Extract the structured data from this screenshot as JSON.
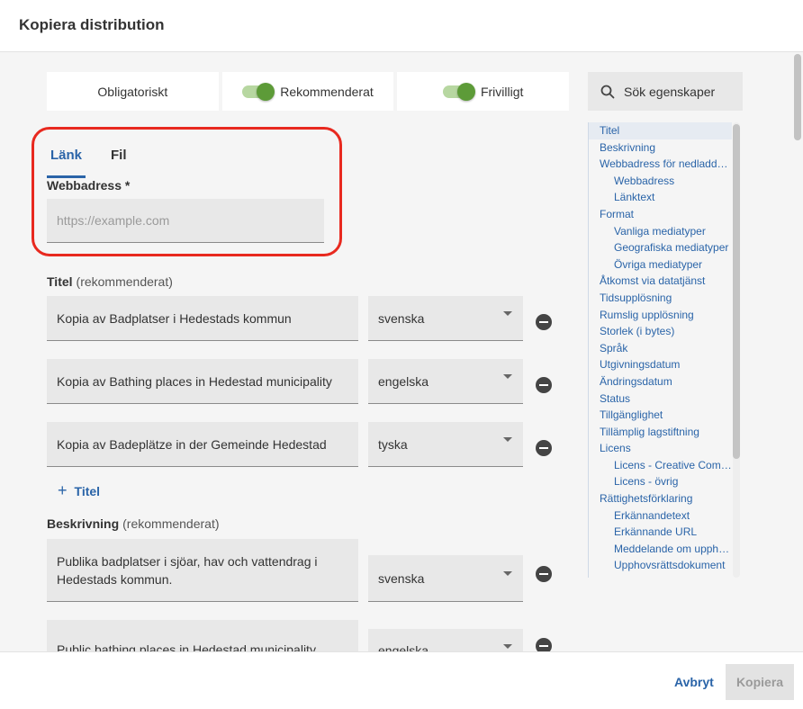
{
  "dialog": {
    "title": "Kopiera distribution"
  },
  "filters": {
    "mandatory": "Obligatoriskt",
    "recommended": "Rekommenderat",
    "optional": "Frivilligt"
  },
  "search": {
    "label": "Sök egenskaper"
  },
  "toc": [
    {
      "label": "Titel",
      "sub": false,
      "active": true
    },
    {
      "label": "Beskrivning",
      "sub": false
    },
    {
      "label": "Webbadress för nedladdning",
      "sub": false
    },
    {
      "label": "Webbadress",
      "sub": true
    },
    {
      "label": "Länktext",
      "sub": true
    },
    {
      "label": "Format",
      "sub": false
    },
    {
      "label": "Vanliga mediatyper",
      "sub": true
    },
    {
      "label": "Geografiska mediatyper",
      "sub": true
    },
    {
      "label": "Övriga mediatyper",
      "sub": true
    },
    {
      "label": "Åtkomst via datatjänst",
      "sub": false
    },
    {
      "label": "Tidsupplösning",
      "sub": false
    },
    {
      "label": "Rumslig upplösning",
      "sub": false
    },
    {
      "label": "Storlek (i bytes)",
      "sub": false
    },
    {
      "label": "Språk",
      "sub": false
    },
    {
      "label": "Utgivningsdatum",
      "sub": false
    },
    {
      "label": "Ändringsdatum",
      "sub": false
    },
    {
      "label": "Status",
      "sub": false
    },
    {
      "label": "Tillgänglighet",
      "sub": false
    },
    {
      "label": "Tillämplig lagstiftning",
      "sub": false
    },
    {
      "label": "Licens",
      "sub": false
    },
    {
      "label": "Licens - Creative Commons",
      "sub": true
    },
    {
      "label": "Licens - övrig",
      "sub": true
    },
    {
      "label": "Rättighetsförklaring",
      "sub": false
    },
    {
      "label": "Erkännandetext",
      "sub": true
    },
    {
      "label": "Erkännande URL",
      "sub": true
    },
    {
      "label": "Meddelande om upphovsrätt",
      "sub": true
    },
    {
      "label": "Upphovsrättsdokument",
      "sub": true
    }
  ],
  "tabs": {
    "link": "Länk",
    "file": "Fil"
  },
  "url": {
    "label": "Webbadress *",
    "placeholder": "https://example.com"
  },
  "title_section": {
    "label": "Titel",
    "hint": "(rekommenderat)",
    "rows": [
      {
        "value": "Kopia av Badplatser i Hedestads kommun",
        "lang": "svenska"
      },
      {
        "value": "Kopia av Bathing places in Hedestad municipality",
        "lang": "engelska"
      },
      {
        "value": "Kopia av Badeplätze in der Gemeinde Hedestad",
        "lang": "tyska"
      }
    ],
    "add_label": "Titel"
  },
  "description_section": {
    "label": "Beskrivning",
    "hint": "(rekommenderat)",
    "rows": [
      {
        "value": "Publika badplatser i sjöar, hav och vattendrag i Hedestads kommun.",
        "lang": "svenska"
      },
      {
        "value": "Public bathing places in Hedestad municipality",
        "lang": "engelska"
      }
    ]
  },
  "footer": {
    "cancel": "Avbryt",
    "copy": "Kopiera"
  }
}
